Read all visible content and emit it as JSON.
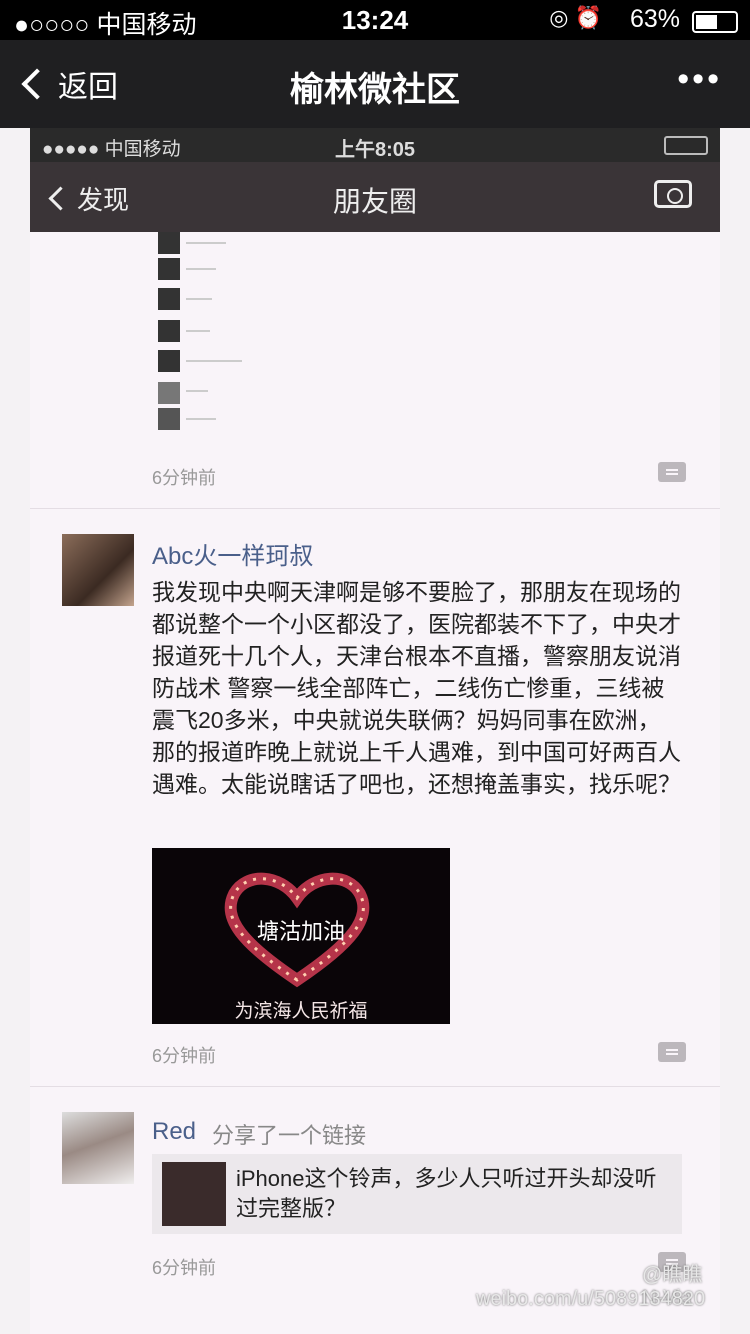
{
  "status_bar": {
    "carrier": "●○○○○ 中国移动",
    "time": "13:24",
    "battery": "63%",
    "battery_level": 0.63,
    "icons": "◎ ⏰"
  },
  "nav": {
    "back": "返回",
    "title": "榆林微社区",
    "more": "•••"
  },
  "inner": {
    "status_bar": {
      "carrier": "●●●●● 中国移动",
      "time": "上午8:05"
    },
    "nav": {
      "back": "发现",
      "title": "朋友圈"
    },
    "posts": [
      {
        "time": "6分钟前"
      },
      {
        "author": "Abc火一样珂叔",
        "text": "我发现中央啊天津啊是够不要脸了，那朋友在现场的都说整个一个小区都没了，医院都装不下了，中央才报道死十几个人，天津台根本不直播，警察朋友说消防战术 警察一线全部阵亡，二线伤亡惨重，三线被震飞20多米，中央就说失联俩？妈妈同事在欧洲，那的报道昨晚上就说上千人遇难，到中国可好两百人遇难。太能说瞎话了吧也，还想掩盖事实，找乐呢？",
        "image_title": "塘沽加油",
        "image_caption": "为滨海人民祈福",
        "time": "6分钟前"
      },
      {
        "author": "Red",
        "action": "分享了一个链接",
        "link_text": "iPhone这个铃声，多少人只听过开头却没听过完整版？",
        "time": "6分钟前"
      }
    ],
    "watermark": "weibo.com/u/5089134820",
    "watermark_user": "@瞧瞧N-Via"
  }
}
